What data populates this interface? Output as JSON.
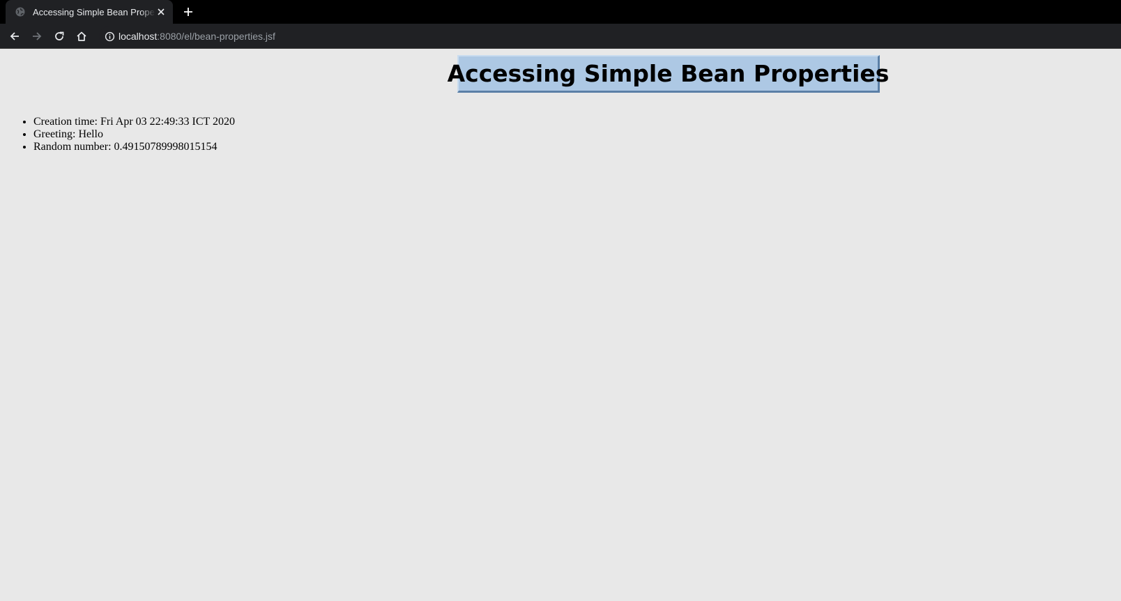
{
  "browser": {
    "tab": {
      "title": "Accessing Simple Bean Properties",
      "favicon": "globe-icon",
      "close_icon": "close-icon"
    },
    "new_tab_icon": "plus-icon",
    "toolbar": {
      "back_icon": "back-arrow-icon",
      "forward_icon": "forward-arrow-icon",
      "reload_icon": "reload-icon",
      "home_icon": "home-icon",
      "site_info_icon": "info-icon"
    },
    "address": {
      "host": "localhost",
      "path": ":8080/el/bean-properties.jsf"
    }
  },
  "page": {
    "title": "Accessing Simple Bean Properties",
    "properties": [
      {
        "label": "Creation time",
        "value": "Fri Apr 03 22:49:33 ICT 2020"
      },
      {
        "label": "Greeting",
        "value": "Hello"
      },
      {
        "label": "Random number",
        "value": "0.49150789998015154"
      }
    ]
  },
  "colors": {
    "page_background": "#e8e8e8",
    "title_box_background": "#adc8e4",
    "chrome_background": "#202124",
    "tabstrip_background": "#000000"
  }
}
